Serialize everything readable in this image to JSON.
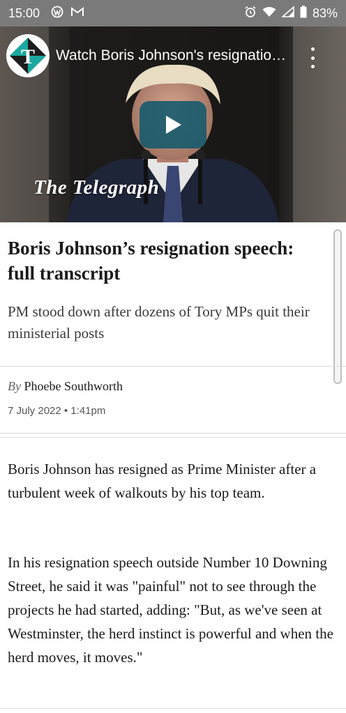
{
  "status_bar": {
    "time": "15:00",
    "battery": "83%",
    "left_icons": [
      "wordpress-icon",
      "gmail-icon"
    ],
    "right_icons": [
      "alarm-icon",
      "wifi-icon",
      "signal-icon",
      "battery-icon"
    ]
  },
  "video": {
    "title": "Watch Boris Johnson's resignation speech",
    "brand_overlay": "The Telegraph",
    "channel_logo": "telegraph-t-logo",
    "play_color": "#175a6e"
  },
  "article": {
    "headline": "Boris Johnson’s resignation speech: full transcript",
    "standfirst": "PM stood down after dozens of Tory MPs quit their ministerial posts",
    "byline_prefix": "By",
    "author": "Phoebe Southworth",
    "date": "7 July 2022 • 1:41pm",
    "paragraphs": [
      "Boris Johnson has resigned as Prime Minister after a turbulent week of walkouts by his top team.",
      "In his resignation speech outside Number 10 Downing Street, he said it was \"painful\" not to see through the projects he had started, adding: \"But, as we've seen at Westminster, the herd instinct is powerful and when the herd moves, it moves.\""
    ]
  }
}
